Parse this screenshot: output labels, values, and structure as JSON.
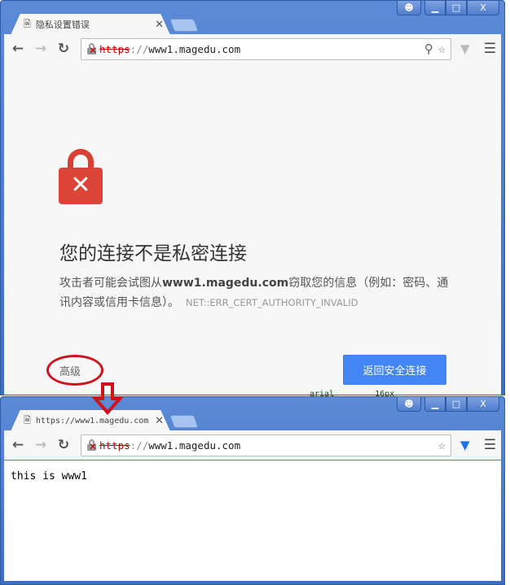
{
  "window1": {
    "tab_title": "隐私设置错误",
    "url": {
      "scheme": "https",
      "rest": "www1.magedu.com"
    },
    "error": {
      "title": "您的连接不是私密连接",
      "desc_before": "攻击者可能会试图从",
      "desc_domain": "www1.magedu.com",
      "desc_after": "窃取您的信息（例如：密码、通讯内容或信用卡信息）。",
      "code": "NET::ERR_CERT_AUTHORITY_INVALID",
      "advanced": "高级",
      "back_button": "返回安全连接"
    }
  },
  "background_strip": {
    "font": "arial",
    "size": "16px"
  },
  "window2": {
    "tab_title": "https://www1.magedu.com",
    "url": {
      "scheme": "https",
      "rest": "www1.magedu.com"
    },
    "body_text": "this is www1"
  },
  "colors": {
    "accent": "#4285f4",
    "danger": "#dc4437",
    "annotation": "#d0121b",
    "frame": "#4f7ccc"
  }
}
